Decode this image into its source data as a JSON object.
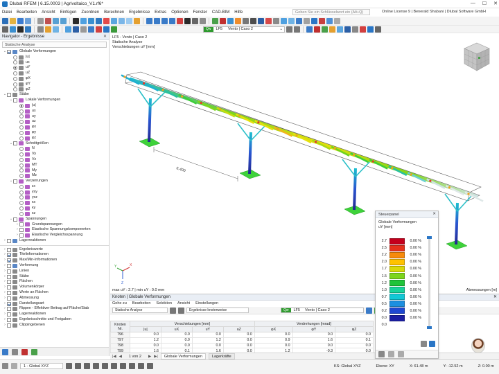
{
  "window": {
    "title": "Dlubal RFEM | 6.15.0003 | Agrivoltaico_V1.rf6*",
    "controls": [
      "—",
      "☐",
      "✕"
    ]
  },
  "menu": {
    "items": [
      "Datei",
      "Bearbeiten",
      "Ansicht",
      "Einfügen",
      "Zuordnen",
      "Berechnen",
      "Ergebnisse",
      "Extras",
      "Optionen",
      "Fenster",
      "CAD-BIM",
      "Hilfe"
    ],
    "search_placeholder": "Geben Sie ein Schlüsselwort ein (Alt+Q)",
    "license": "Online License 9 | Benerald Shabani | Dlubal Software GmbH"
  },
  "toolbar": {
    "loadcase_badge": "Qw",
    "loadcase_id": "LF5",
    "loadcase_name": "Vento | Caso 2",
    "table_badge": "Qw",
    "table_id": "LF5",
    "table_name": "Vento | Caso 2"
  },
  "navigator": {
    "title": "Navigator - Ergebnisse",
    "combo": "Statische Analyse",
    "tree": [
      {
        "level": 0,
        "exp": "⌄",
        "ctl": "chk",
        "on": true,
        "label": "Globale Verformungen",
        "icon": "#5a87c6"
      },
      {
        "level": 1,
        "exp": "",
        "ctl": "rad",
        "on": false,
        "label": "|u|",
        "icon": "#8a8a8a"
      },
      {
        "level": 1,
        "exp": "",
        "ctl": "rad",
        "on": false,
        "label": "ux",
        "icon": "#8a8a8a"
      },
      {
        "level": 1,
        "exp": "",
        "ctl": "rad",
        "on": true,
        "label": "uY",
        "icon": "#8a8a8a"
      },
      {
        "level": 1,
        "exp": "",
        "ctl": "rad",
        "on": false,
        "label": "uZ",
        "icon": "#8a8a8a"
      },
      {
        "level": 1,
        "exp": "",
        "ctl": "rad",
        "on": false,
        "label": "φX",
        "icon": "#8a8a8a"
      },
      {
        "level": 1,
        "exp": "",
        "ctl": "rad",
        "on": false,
        "label": "φY",
        "icon": "#8a8a8a"
      },
      {
        "level": 1,
        "exp": "",
        "ctl": "rad",
        "on": false,
        "label": "φZ",
        "icon": "#8a8a8a"
      },
      {
        "level": 0,
        "exp": "⌄",
        "ctl": "chk",
        "on": false,
        "label": "Stäbe",
        "icon": "#8a8a8a"
      },
      {
        "level": 1,
        "exp": "⌄",
        "ctl": "chk",
        "on": false,
        "label": "Lokale Verformungen",
        "icon": "#b45fc5"
      },
      {
        "level": 2,
        "exp": "",
        "ctl": "rad",
        "on": true,
        "label": "|u|",
        "icon": "#b45fc5"
      },
      {
        "level": 2,
        "exp": "",
        "ctl": "rad",
        "on": false,
        "label": "ux",
        "icon": "#b45fc5"
      },
      {
        "level": 2,
        "exp": "",
        "ctl": "rad",
        "on": false,
        "label": "uy",
        "icon": "#b45fc5"
      },
      {
        "level": 2,
        "exp": "",
        "ctl": "rad",
        "on": false,
        "label": "uz",
        "icon": "#b45fc5"
      },
      {
        "level": 2,
        "exp": "",
        "ctl": "rad",
        "on": false,
        "label": "φx",
        "icon": "#b45fc5"
      },
      {
        "level": 2,
        "exp": "",
        "ctl": "rad",
        "on": false,
        "label": "φy",
        "icon": "#b45fc5"
      },
      {
        "level": 2,
        "exp": "",
        "ctl": "rad",
        "on": false,
        "label": "φz",
        "icon": "#b45fc5"
      },
      {
        "level": 1,
        "exp": "⌄",
        "ctl": "chk",
        "on": false,
        "label": "Schnittgrößen",
        "icon": "#b45fc5"
      },
      {
        "level": 2,
        "exp": "",
        "ctl": "rad",
        "on": false,
        "label": "N",
        "icon": "#b45fc5"
      },
      {
        "level": 2,
        "exp": "",
        "ctl": "rad",
        "on": false,
        "label": "Vy",
        "icon": "#b45fc5"
      },
      {
        "level": 2,
        "exp": "",
        "ctl": "rad",
        "on": false,
        "label": "Vz",
        "icon": "#b45fc5"
      },
      {
        "level": 2,
        "exp": "",
        "ctl": "rad",
        "on": false,
        "label": "MT",
        "icon": "#b45fc5"
      },
      {
        "level": 2,
        "exp": "",
        "ctl": "rad",
        "on": false,
        "label": "My",
        "icon": "#b45fc5"
      },
      {
        "level": 2,
        "exp": "",
        "ctl": "rad",
        "on": false,
        "label": "Mz",
        "icon": "#b45fc5"
      },
      {
        "level": 1,
        "exp": "⌄",
        "ctl": "chk",
        "on": false,
        "label": "Verzerrungen",
        "icon": "#b45fc5"
      },
      {
        "level": 2,
        "exp": "",
        "ctl": "rad",
        "on": false,
        "label": "εx",
        "icon": "#b45fc5"
      },
      {
        "level": 2,
        "exp": "",
        "ctl": "rad",
        "on": false,
        "label": "γxy",
        "icon": "#b45fc5"
      },
      {
        "level": 2,
        "exp": "",
        "ctl": "rad",
        "on": false,
        "label": "γxz",
        "icon": "#b45fc5"
      },
      {
        "level": 2,
        "exp": "",
        "ctl": "rad",
        "on": false,
        "label": "κx",
        "icon": "#b45fc5"
      },
      {
        "level": 2,
        "exp": "",
        "ctl": "rad",
        "on": false,
        "label": "κy",
        "icon": "#b45fc5"
      },
      {
        "level": 2,
        "exp": "",
        "ctl": "rad",
        "on": false,
        "label": "κz",
        "icon": "#b45fc5"
      },
      {
        "level": 1,
        "exp": "⌄",
        "ctl": "chk",
        "on": false,
        "label": "Spannungen",
        "icon": "#b45fc5"
      },
      {
        "level": 2,
        "exp": "›",
        "ctl": "chk",
        "on": false,
        "label": "Grundspannungen",
        "icon": "#b45fc5"
      },
      {
        "level": 2,
        "exp": "›",
        "ctl": "chk",
        "on": false,
        "label": "Elastische Spannungskomponenten",
        "icon": "#b45fc5"
      },
      {
        "level": 2,
        "exp": "›",
        "ctl": "chk",
        "on": false,
        "label": "Elastische Vergleichsspannung",
        "icon": "#b45fc5"
      },
      {
        "level": 0,
        "exp": "›",
        "ctl": "chk",
        "on": false,
        "label": "Lagerreaktionen",
        "icon": "#5a87c6"
      }
    ],
    "tree2": [
      {
        "exp": "›",
        "on": false,
        "label": "Ergebniswerte",
        "icon": "#8a8a8a"
      },
      {
        "exp": "›",
        "on": true,
        "label": "Titelinformationen",
        "icon": "#8a8a8a"
      },
      {
        "exp": "›",
        "on": true,
        "label": "Max/Min-Informationen",
        "icon": "#8a8a8a"
      },
      {
        "exp": "›",
        "on": false,
        "label": "Verformung",
        "icon": "#5a87c6"
      },
      {
        "exp": "›",
        "on": false,
        "label": "Linien",
        "icon": "#8a8a8a"
      },
      {
        "exp": "›",
        "on": false,
        "label": "Stäbe",
        "icon": "#8a8a8a"
      },
      {
        "exp": "›",
        "on": false,
        "label": "Flächen",
        "icon": "#8a8a8a"
      },
      {
        "exp": "›",
        "on": false,
        "label": "Volumenkörper",
        "icon": "#8a8a8a"
      },
      {
        "exp": "›",
        "on": false,
        "label": "Werte an Flächen",
        "icon": "#8a8a8a"
      },
      {
        "exp": "›",
        "on": false,
        "label": "Abmessung",
        "icon": "#8a8a8a"
      },
      {
        "exp": "›",
        "on": true,
        "label": "Darstellungsart",
        "icon": "#8a8a8a"
      },
      {
        "exp": "›",
        "on": false,
        "label": "Rippen - Effektiver Beitrag auf Fläche/Stab",
        "icon": "#8a8a8a"
      },
      {
        "exp": "›",
        "on": false,
        "label": "Lagerreaktionen",
        "icon": "#8a8a8a"
      },
      {
        "exp": "›",
        "on": false,
        "label": "Ergebnisschnitte und Freigaben",
        "icon": "#8a8a8a"
      },
      {
        "exp": "›",
        "on": false,
        "label": "Clippingebenen",
        "icon": "#8a8a8a"
      }
    ]
  },
  "view": {
    "info_lines": [
      "LF5 - Vento | Caso 2",
      "Statische Analyse",
      "Verschiebungen uY [mm]"
    ],
    "dimension_label": "6.400",
    "maxmin": "max uY : 2.7 | min uY : 0.0 mm",
    "dim_unit": "Abmessungen [m]",
    "axes": {
      "x": "X",
      "y": "Y",
      "z": "Z"
    }
  },
  "control_panel": {
    "header": "Steuerpanel",
    "title": "Globale Verformungen",
    "unit": "uY [mm]",
    "legend": [
      {
        "value": "2.7",
        "color": "#c4001d",
        "pct": "0.00 %"
      },
      {
        "value": "2.5",
        "color": "#e6311c",
        "pct": "0.00 %"
      },
      {
        "value": "2.2",
        "color": "#f78a0b",
        "pct": "0.00 %"
      },
      {
        "value": "2.0",
        "color": "#ffc200",
        "pct": "0.00 %"
      },
      {
        "value": "1.7",
        "color": "#d9d90a",
        "pct": "0.00 %"
      },
      {
        "value": "1.5",
        "color": "#7cd51b",
        "pct": "0.00 %"
      },
      {
        "value": "1.2",
        "color": "#1fc43a",
        "pct": "0.00 %"
      },
      {
        "value": "1.0",
        "color": "#17d39a",
        "pct": "0.00 %"
      },
      {
        "value": "0.7",
        "color": "#12c8d6",
        "pct": "0.00 %"
      },
      {
        "value": "0.5",
        "color": "#1d8fe0",
        "pct": "0.00 %"
      },
      {
        "value": "0.2",
        "color": "#1f48d2",
        "pct": "0.00 %"
      },
      {
        "value": "0.0",
        "color": "#1b1ea3",
        "pct": "0.00 %"
      },
      {
        "value": "0.0",
        "color": "",
        "pct": ""
      }
    ]
  },
  "table_panel": {
    "title": "Knoten | Globale Verformungen",
    "menu": [
      "Gehe zu",
      "Bearbeiten",
      "Selektion",
      "Ansicht",
      "Einstellungen"
    ],
    "analysis": "Statische Analyse",
    "results_mode": "Ergebnisse knotenweise",
    "headers": {
      "nr": "Knoten Nr.",
      "group1": "Verschiebungen [mm]",
      "group2": "Verdrehungen [mrad]",
      "cols": [
        "|u|",
        "uX",
        "uY",
        "uZ",
        "φX",
        "φY",
        "φZ"
      ]
    },
    "rows": [
      {
        "nr": "796",
        "c": [
          "0.0",
          "0.0",
          "0.0",
          "0.0",
          "0.0",
          "0.0",
          "0.0"
        ]
      },
      {
        "nr": "797",
        "c": [
          "1.2",
          "0.0",
          "1.2",
          "0.0",
          "0.9",
          "1.6",
          "0.1"
        ]
      },
      {
        "nr": "798",
        "c": [
          "0.0",
          "0.0",
          "0.0",
          "0.0",
          "0.0",
          "0.0",
          "0.0"
        ]
      },
      {
        "nr": "799",
        "c": [
          "1.6",
          "0.1",
          "1.6",
          "0.0",
          "1.2",
          "-0.3",
          "0.0"
        ]
      },
      {
        "nr": "800",
        "c": [
          "0.0",
          "0.0",
          "0.0",
          "0.0",
          "0.0",
          "0.0",
          "0.0"
        ]
      }
    ],
    "pager": "1 von 2",
    "tabs": [
      "Globale Verformungen",
      "Lagerkräfte"
    ]
  },
  "status": {
    "coord_system": "1 - Global XYZ",
    "ks": "KS: Global XYZ",
    "plane": "Ebene: XY",
    "x": "X: 61.48 m",
    "y": "Y: -12.52 m",
    "z": "Z: 0.00 m"
  }
}
